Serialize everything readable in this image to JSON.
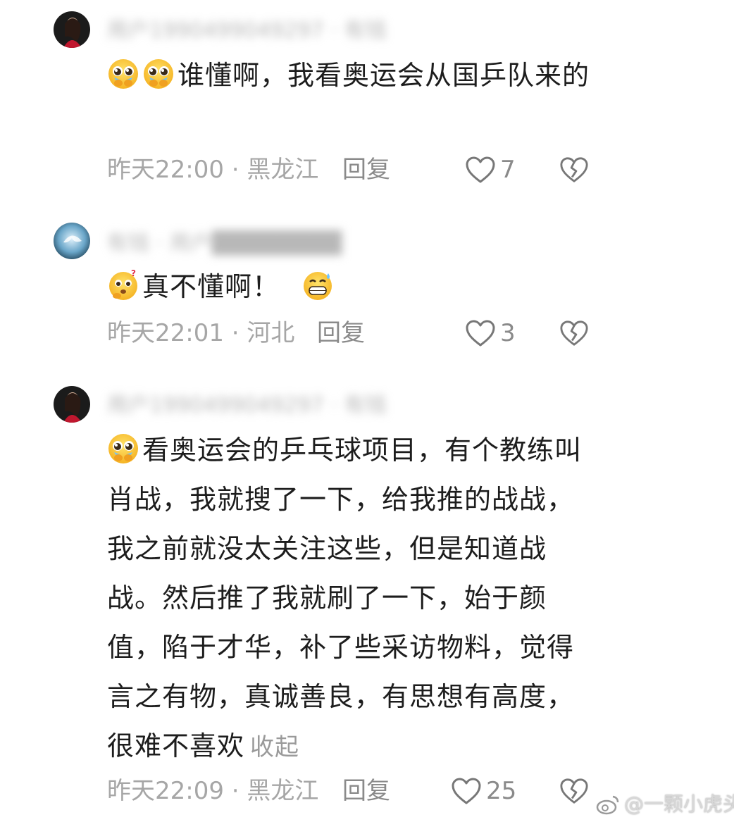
{
  "comments": [
    {
      "username": "用户1990499049297 · 有钱",
      "text": "谁懂啊，我看奥运会从国乒队来的",
      "meta": "昨天22:00 · 黑龙江",
      "reply_label": "回复",
      "likes": "7"
    },
    {
      "username": "有钱 · 用户████████",
      "text": "真不懂啊！",
      "meta": "昨天22:01 · 河北",
      "reply_label": "回复",
      "likes": "3"
    },
    {
      "username": "用户1990499049297 · 有钱",
      "text": "看奥运会的乒乓球项目，有个教练叫肖战，我就搜了一下，给我推的战战，我之前就没太关注这些，但是知道战战。然后推了我就刷了一下，始于颜值，陷于才华，补了些采访物料，觉得言之有物，真诚善良，有思想有高度，很难不喜欢",
      "collapse_label": "收起",
      "meta": "昨天22:09 · 黑龙江",
      "reply_label": "回复",
      "likes": "25"
    }
  ],
  "watermark": "@一颗小虎头",
  "icons": {
    "like": "heart-outline-icon",
    "dislike": "broken-heart-icon",
    "weibo": "weibo-logo-icon"
  },
  "colors": {
    "text": "#1d1d1d",
    "meta": "#a6a6a6",
    "action": "#8a8a8a"
  }
}
